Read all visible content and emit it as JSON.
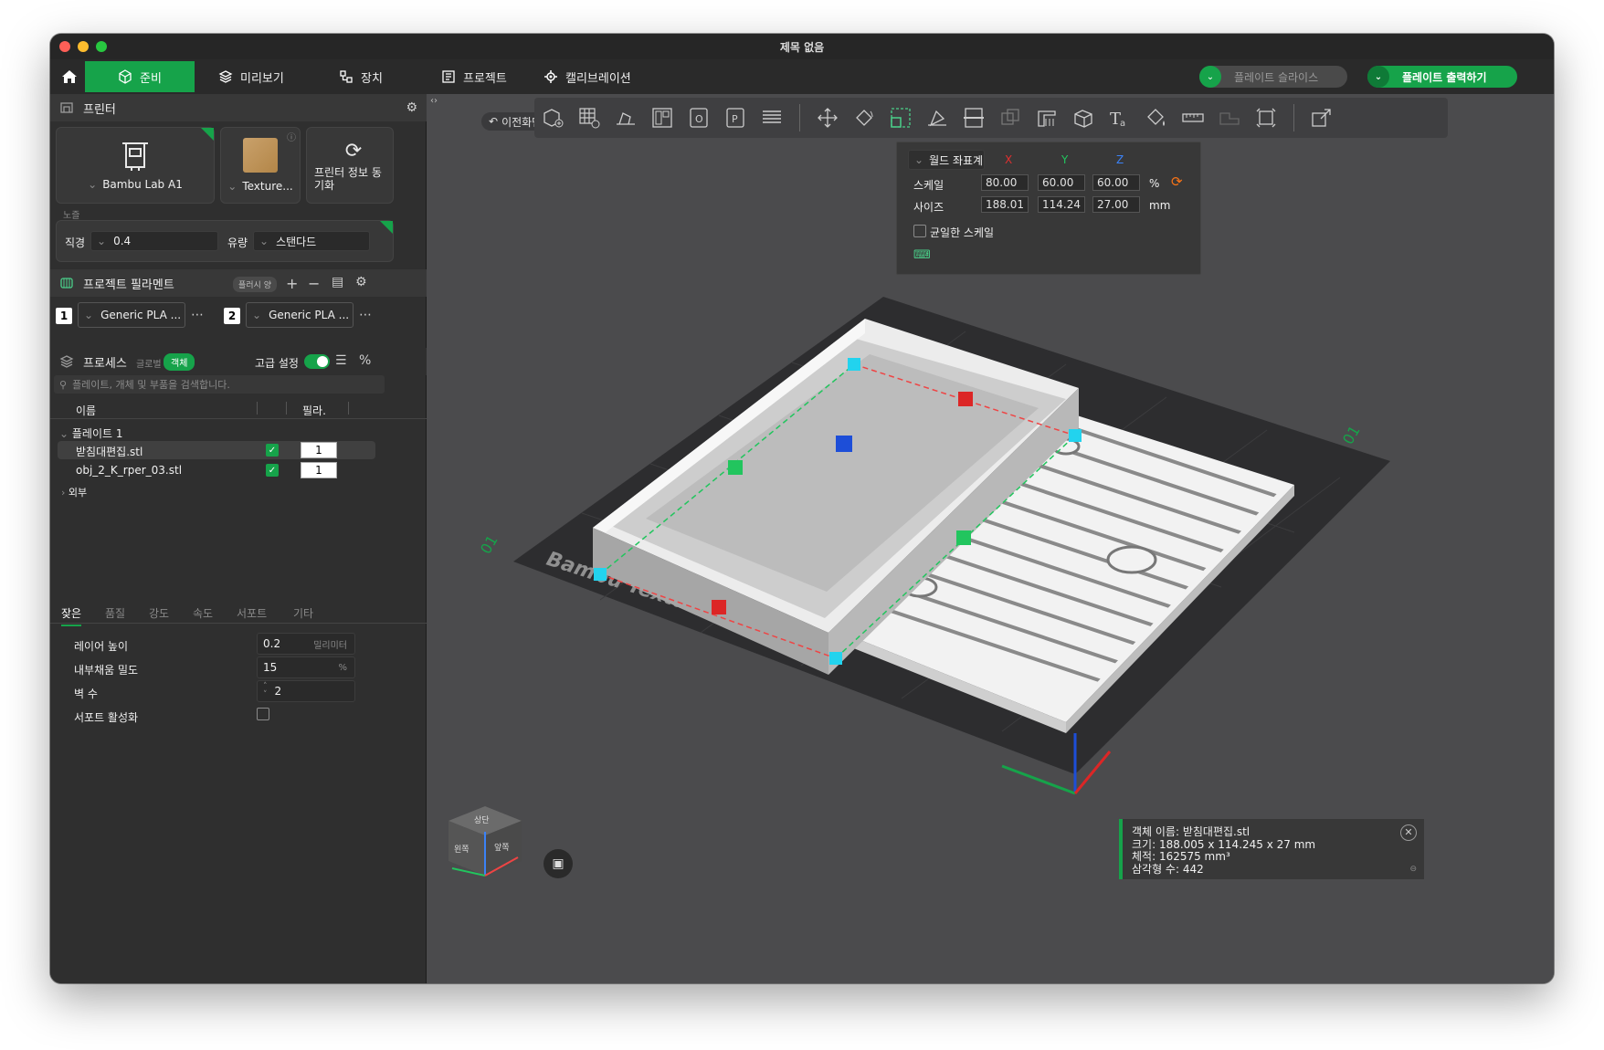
{
  "window": {
    "title": "제목 없음"
  },
  "tabs": [
    {
      "label": "준비",
      "icon": "cube-icon"
    },
    {
      "label": "미리보기",
      "icon": "layers-icon"
    },
    {
      "label": "장치",
      "icon": "device-icon"
    },
    {
      "label": "프로젝트",
      "icon": "project-icon"
    },
    {
      "label": "캘리브레이션",
      "icon": "calibration-icon"
    }
  ],
  "actions": {
    "slice_label": "플레이트 슬라이스",
    "print_label": "플레이트 출력하기"
  },
  "printer": {
    "section_title": "프린터",
    "printer_name": "Bambu Lab A1",
    "plate_name": "Texture...",
    "sync_label": "프린터 정보 동기화",
    "nozzle_label": "노즐",
    "diameter_label": "직경",
    "diameter_value": "0.4",
    "flow_label": "유량",
    "flow_value": "스탠다드"
  },
  "filament": {
    "section_title": "프로젝트 필라멘트",
    "flush_label": "플러시 양",
    "slots": [
      {
        "index": "1",
        "name": "Generic PLA ..."
      },
      {
        "index": "2",
        "name": "Generic PLA ..."
      }
    ]
  },
  "process": {
    "section_title": "프로세스",
    "global_label": "글로벌",
    "object_label": "객체",
    "advanced_label": "고급 설정",
    "search_placeholder": "플레이트, 개체 및 부품을 검색합니다.",
    "col_name": "이름",
    "col_filament": "필라.",
    "plate_label": "플레이트 1",
    "objects": [
      {
        "name": "받침대편집.stl",
        "filament": "1",
        "checked": true
      },
      {
        "name": "obj_2_K_rper_03.stl",
        "filament": "1",
        "checked": true
      }
    ],
    "outside_label": "외부"
  },
  "settings_tabs": [
    "잦은",
    "품질",
    "강도",
    "속도",
    "서포트",
    "기타"
  ],
  "settings": {
    "layer_height_label": "레이어 높이",
    "layer_height_value": "0.2",
    "layer_height_unit": "밀리미터",
    "infill_label": "내부채움 밀도",
    "infill_value": "15",
    "infill_unit": "%",
    "walls_label": "벽 수",
    "walls_value": "2",
    "support_label": "서포트 활성화"
  },
  "viewport": {
    "back_label": "이전화면",
    "coord_mode": "월드 좌표계",
    "axis_x": "X",
    "axis_y": "Y",
    "axis_z": "Z",
    "scale_label": "스케일",
    "scale": [
      "80.00",
      "60.00",
      "60.00"
    ],
    "scale_unit": "%",
    "size_label": "사이즈",
    "size": [
      "188.01",
      "114.24",
      "27.00"
    ],
    "size_unit": "mm",
    "uniform_label": "균일한 스케일",
    "plate_text": "Bambu Textured PEI Plate",
    "plate_num_left": "01",
    "plate_num_right": "01",
    "cube_label_top": "상단",
    "cube_label_front": "앞쪽",
    "cube_label_left": "왼쪽",
    "info": {
      "line1": "객체 이름: 받침대편집.stl",
      "line2": "크기: 188.005 x 114.245 x 27 mm",
      "line3": "체적: 162575 mm³",
      "line4": "삼각형 수: 442"
    }
  },
  "colors": {
    "accent": "#16a34a",
    "bg": "#2f2f2f",
    "viewport": "#4b4b4d"
  }
}
